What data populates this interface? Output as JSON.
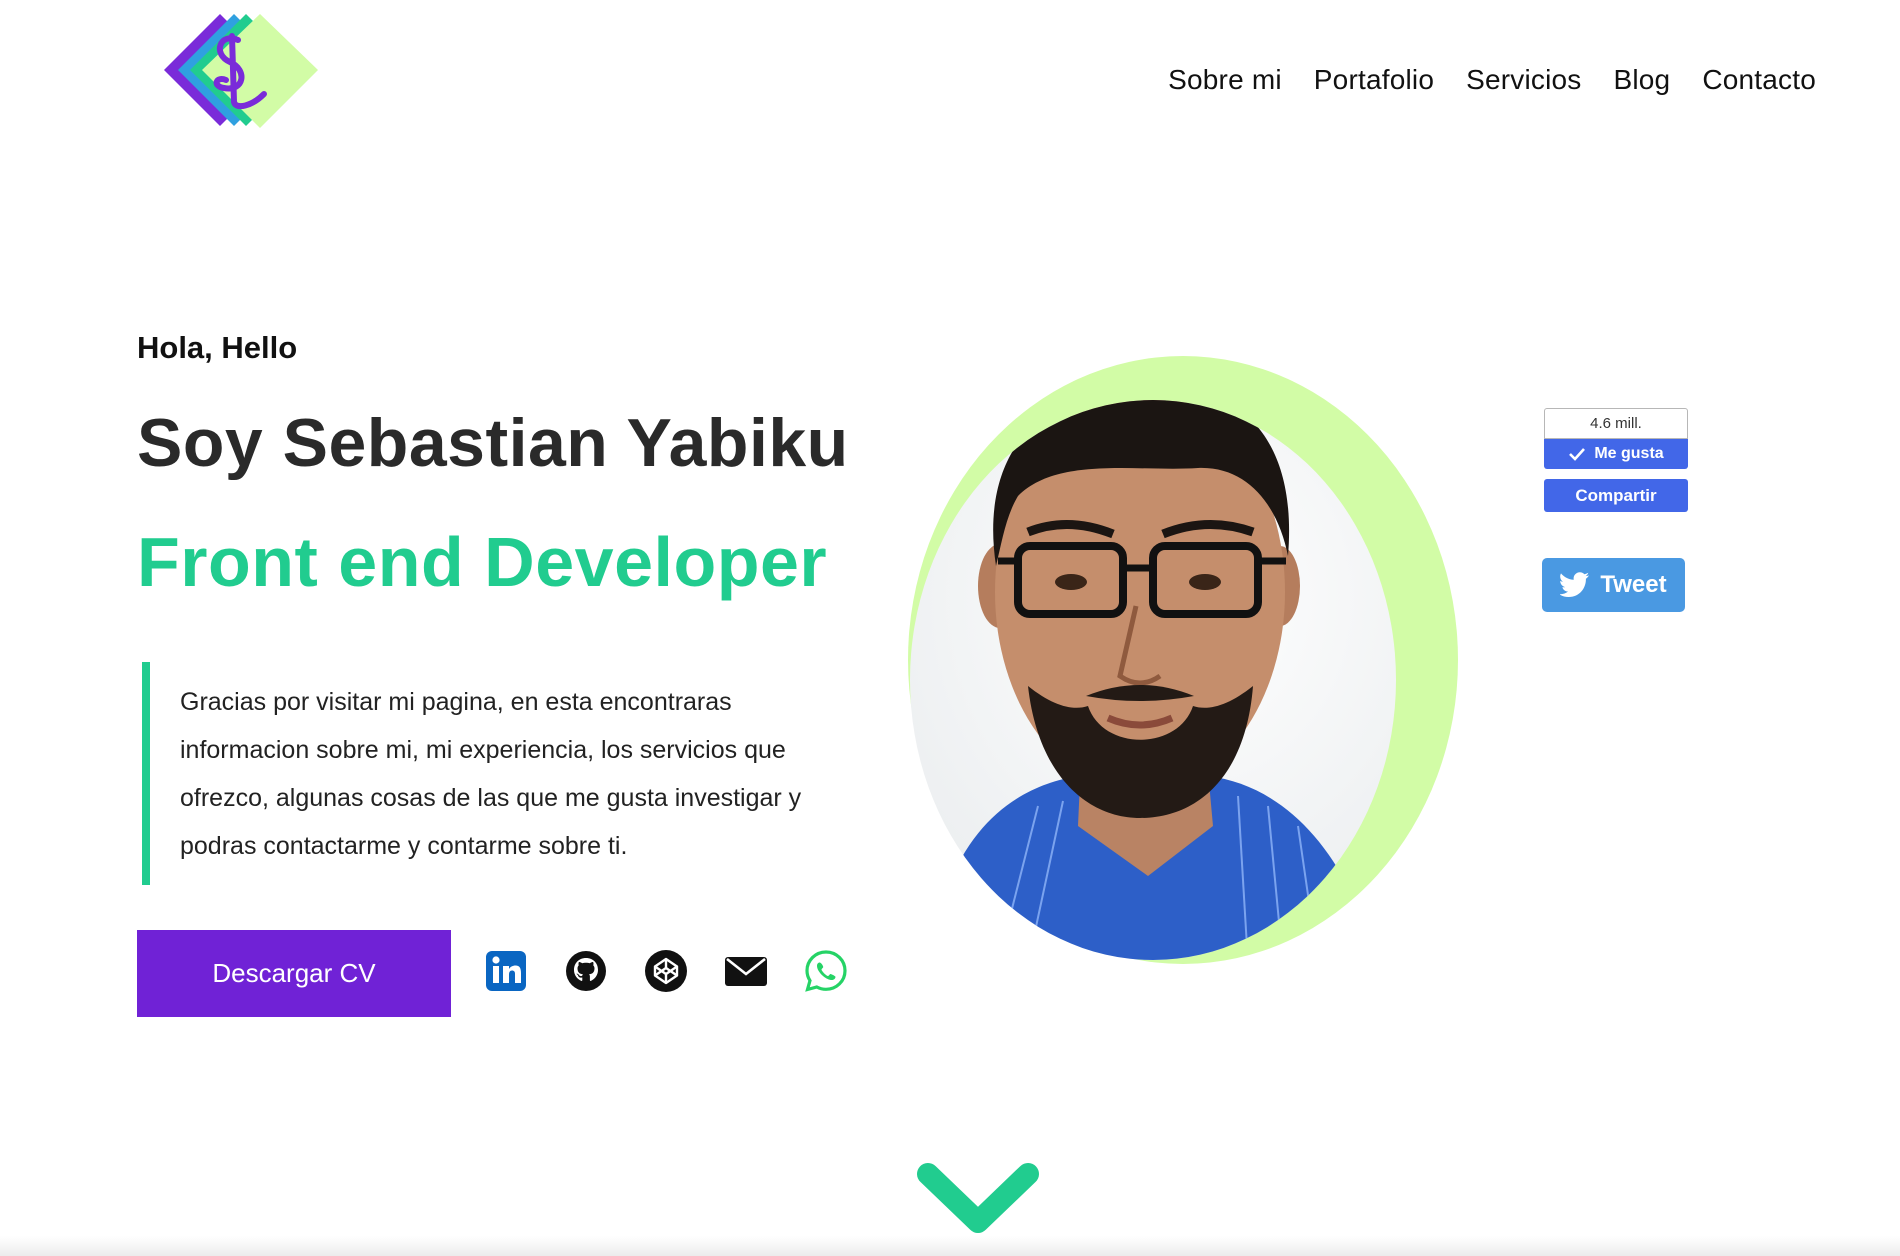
{
  "colors": {
    "accent_green": "#21cc8f",
    "accent_purple": "#7022d6",
    "light_green": "#d2fca6",
    "facebook_blue": "#4267e8",
    "twitter_blue": "#4a99e2"
  },
  "header": {
    "logo_icon": "site-logo-diamond-s",
    "nav": [
      "Sobre mi",
      "Portafolio",
      "Servicios",
      "Blog",
      "Contacto"
    ]
  },
  "hero": {
    "greeting": "Hola, Hello",
    "name": "Soy Sebastian Yabiku",
    "role": "Front end Developer",
    "intro": "Gracias por visitar mi pagina, en esta encontraras informacion sobre mi, mi experiencia, los servicios que ofrezco, algunas cosas de las que me gusta investigar y podras contactarme y contarme sobre ti.",
    "cv_button": "Descargar CV",
    "socials": [
      "linkedin-icon",
      "github-icon",
      "codepen-icon",
      "email-icon",
      "whatsapp-icon"
    ]
  },
  "share": {
    "likes_count": "4.6 mill.",
    "like_label": "Me gusta",
    "share_label": "Compartir",
    "tweet_label": "Tweet"
  },
  "scroll_icon": "chevron-down-icon"
}
